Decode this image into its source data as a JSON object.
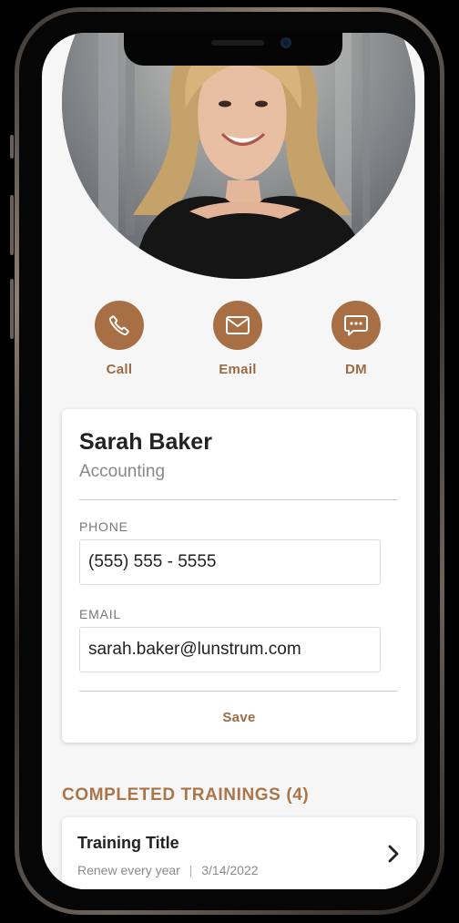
{
  "actions": [
    {
      "label": "Call",
      "icon": "phone-icon"
    },
    {
      "label": "Email",
      "icon": "mail-icon"
    },
    {
      "label": "DM",
      "icon": "message-icon"
    }
  ],
  "profile": {
    "name": "Sarah Baker",
    "department": "Accounting",
    "phone_label": "PHONE",
    "phone_value": "(555) 555 - 5555",
    "email_label": "EMAIL",
    "email_value": "sarah.baker@lunstrum.com",
    "save_label": "Save"
  },
  "trainings": {
    "title": "COMPLETED TRAININGS (4)",
    "items": [
      {
        "title": "Training Title",
        "frequency": "Renew every year",
        "date": "3/14/2022"
      }
    ]
  },
  "colors": {
    "accent": "#a86f45",
    "accent_text": "#9c6b45"
  }
}
